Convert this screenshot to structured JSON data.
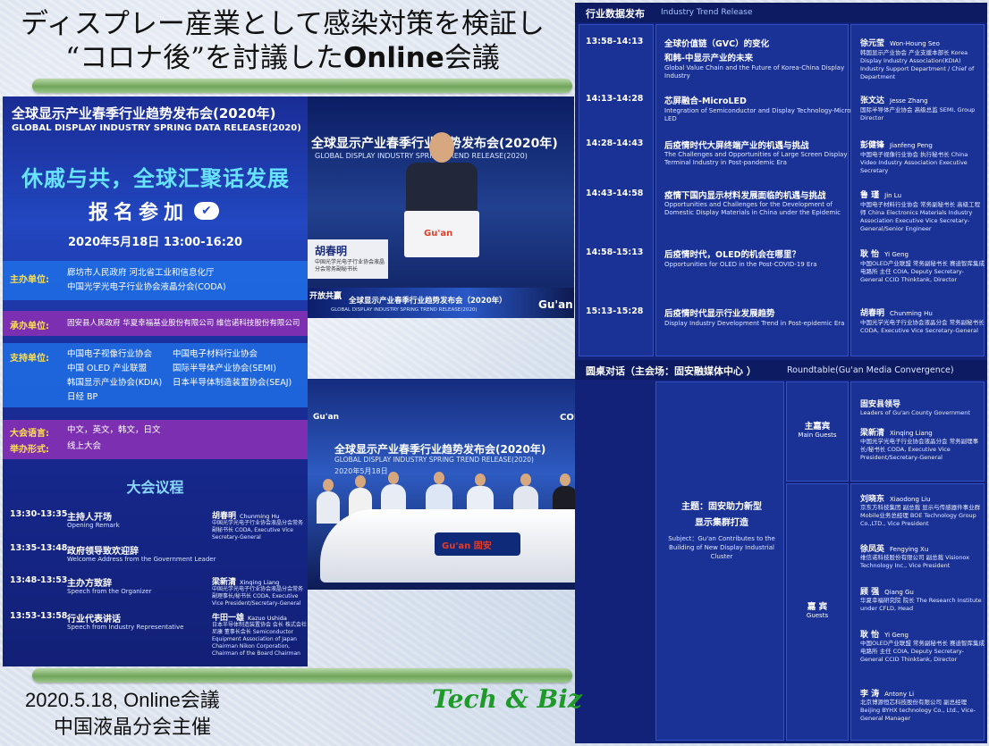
{
  "slide": {
    "title_line1": "ディスプレー産業として感染対策を検証し",
    "title_line2_prefix": "“コロナ後”を討議した",
    "title_line2_bold": "Online",
    "title_line2_suffix": "会議",
    "footer_date": "2020.5.18, Online会議",
    "footer_host": "中国液晶分会主催",
    "brand": "Tech & Biz"
  },
  "poster": {
    "title_zh": "全球显示产业春季行业趋势发布会(2020年)",
    "title_en": "GLOBAL DISPLAY INDUSTRY SPRING DATA RELEASE(2020)",
    "slogan": "休戚与共，全球汇聚话发展",
    "register": "报名参加",
    "check": "✔",
    "date": "2020年5月18日 13:00-16:20",
    "host_label": "主办单位:",
    "host_line1": "廊坊市人民政府   河北省工业和信息化厅",
    "host_line2": "中国光学光电子行业协会液晶分会(CODA)",
    "organizer_label": "承办单位:",
    "organizer_value": "固安县人民政府   华夏幸福基业股份有限公司   维信诺科技股份有限公司",
    "support_label": "支持单位:",
    "support_l1a": "中国电子视像行业协会",
    "support_l1b": "中国电子材料行业协会",
    "support_l2a": "中国 OLED 产业联盟",
    "support_l2b": "国际半导体产业协会(SEMI)",
    "support_l3a": "韩国显示产业协会(KDIA)",
    "support_l3b": "日本半导体制造装置协会(SEAJ)",
    "support_l4": "日经 BP",
    "lang_label": "大会语言:",
    "lang_value": "中文，英文，韩文，日文",
    "format_label": "举办形式:",
    "format_value": "线上大会",
    "agenda_title": "大会议程",
    "agenda": [
      {
        "time": "13:30-13:35",
        "zh": "主持人开场",
        "en": "Opening Remark",
        "speaker": "胡春明",
        "speaker_en": "Chunming Hu",
        "desc": "中国光学光电子行业协会液晶分会常务副秘书长 CODA, Executive Vice Secretary-General"
      },
      {
        "time": "13:35-13:48",
        "zh": "政府领导致欢迎辞",
        "en": "Welcome Address from the Government Leader",
        "speaker": "",
        "speaker_en": "",
        "desc": ""
      },
      {
        "time": "13:48-13:53",
        "zh": "主办方致辞",
        "en": "Speech from the Organizer",
        "speaker": "梁新清",
        "speaker_en": "Xinqing Liang",
        "desc": "中国光学光电子行业协会液晶分会常务副理事长/秘书长 CODA, Executive Vice President/Secretary-General"
      },
      {
        "time": "13:53-13:58",
        "zh": "行业代表讲话",
        "en": "Speech from Industry Representative",
        "speaker": "牛田一雄",
        "speaker_en": "Kazuo Ushida",
        "desc": "日本半导体制造装置协会 会长 株式会社尼康 董事长会长 Semiconductor Equipment Association of Japan Chairman Nikon Corporation, Chairman of the Board Chairman"
      }
    ]
  },
  "frame1": {
    "banner_zh": "全球显示产业春季行业趋势发布会(2020年)",
    "banner_en": "GLOBAL DISPLAY INDUSTRY SPRING TREND RELEASE(2020)",
    "name": "胡春明",
    "name_title": "中国光学光电子行业协会液晶分会常务副秘书长",
    "ticker_zh": "全球显示产业春季行业趋势发布会（2020年）",
    "ticker_en": "GLOBAL DISPLAY INDUSTRY SPRING TREND RELEASE(2020)",
    "logo": "Gu'an",
    "podium_logo": "Gu'an",
    "ticker_left": "开放共赢"
  },
  "frame2": {
    "logo_left": "Gu'an",
    "logo_coda": "CODA",
    "banner_zh": "全球显示产业春季行业趋势发布会(2020年)",
    "banner_en": "GLOBAL DISPLAY INDUSTRY SPRING TREND RELEASE(2020)",
    "date": "2020年5月18日",
    "desk_logo": "Gu'an 固安"
  },
  "program": {
    "release_header_zh": "行业数据发布",
    "release_header_en": "Industry Trend Release",
    "items": [
      {
        "time": "13:58-14:13",
        "zh1": "全球价值链（GVC）的变化",
        "zh2": "和韩-中显示产业的未来",
        "en": "Global Value Chain and the Future of Korea-China Display Industry",
        "speaker": "徐元莹",
        "speaker_en": "Won-Houng Seo",
        "desc": "韩国显示产业协会 产业支援本部长 Korea Display Industry Association(KDIA) Industry Support Department / Chief of Department"
      },
      {
        "time": "14:13-14:28",
        "zh1": "芯屏融合-MicroLED",
        "zh2": "",
        "en": "Integration of Semiconductor and Display Technology-Micro LED",
        "speaker": "张文达",
        "speaker_en": "Jesse Zhang",
        "desc": "国际半导体产业协会 高级总监 SEMI, Group Director"
      },
      {
        "time": "14:28-14:43",
        "zh1": "后疫情时代大屏终端产业的机遇与挑战",
        "zh2": "",
        "en": "The Challenges and Opportunities of Large Screen Display Terminal Industry in Post-pandemic Era",
        "speaker": "彭健锋",
        "speaker_en": "Jianfeng Peng",
        "desc": "中国电子视像行业协会 执行秘书长 China Video Industry Association Executive Secretary"
      },
      {
        "time": "14:43-14:58",
        "zh1": "疫情下国内显示材料发展面临的机遇与挑战",
        "zh2": "",
        "en": "Opportunities and Challenges for the Development of Domestic Display Materials in China under the Epidemic",
        "speaker": "鲁  瑾",
        "speaker_en": "Jin Lu",
        "desc": "中国电子材料行业协会 常务副秘书长 高级工程师 China Electronics Materials Industry Association Executive Vice Secretary-General/Senior Engineer"
      },
      {
        "time": "14:58-15:13",
        "zh1": "后疫情时代，OLED的机会在哪里？",
        "zh2": "",
        "en": "Opportunities for OLED in the Post-COVID-19 Era",
        "speaker": "耿  怡",
        "speaker_en": "Yi Geng",
        "desc": "中国OLED产业联盟 常务副秘书长 赛迪智库集成电路所 主任 COIA, Deputy Secretary-General CCID Thinktank, Director"
      },
      {
        "time": "15:13-15:28",
        "zh1": "后疫情时代显示行业发展趋势",
        "zh2": "",
        "en": "Display Industry Development Trend in Post-epidemic Era",
        "speaker": "胡春明",
        "speaker_en": "Chunming Hu",
        "desc": "中国光学光电子行业协会液晶分会 常务副秘书长 CODA, Executive Vice Secretary-General"
      }
    ],
    "roundtable_zh": "圆桌对话（主会场：固安融媒体中心 ）",
    "roundtable_en": "Roundtable(Gu'an Media Convergence)",
    "theme_zh1": "主题：固安助力新型",
    "theme_zh2": "显示集群打造",
    "theme_en": "Subject：Gu'an Contributes to the Building of New Display Industrial Cluster",
    "main_guests_zh": "主嘉宾",
    "main_guests_en": "Main Guests",
    "guests_zh": "嘉  宾",
    "guests_en": "Guests",
    "main_guests": [
      {
        "name": "固安县领导",
        "en": "",
        "desc": "Leaders of Gu'an County Government"
      },
      {
        "name": "梁新清",
        "en": "Xinqing Liang",
        "desc": "中国光学光电子行业协会液晶分会 常务副理事长/秘书长 CODA, Executive Vice President/Secretary-General"
      }
    ],
    "guests": [
      {
        "name": "刘晓东",
        "en": "Xiaodong Liu",
        "desc": "京东方科技集团 副总裁 显示与传感器件事业群 Mobile业务总经理 BOE Technology Group Co.,LTD., Vice President"
      },
      {
        "name": "徐凤英",
        "en": "Fengying Xu",
        "desc": "维信诺科技股份有限公司 副总裁 Visionox Technology Inc., Vice President"
      },
      {
        "name": "顾  强",
        "en": "Qiang Gu",
        "desc": "华夏幸福研究院 院长 The Research Institute under CFLD, Head"
      },
      {
        "name": "耿  怡",
        "en": "Yi Geng",
        "desc": "中国OLED产业联盟 常务副秘书长 赛迪智库集成电路所 主任 COIA, Deputy Secretary-General CCID Thinktank, Director"
      },
      {
        "name": "李  涛",
        "en": "Antony Li",
        "desc": "北京博源恒芯科技股份有限公司 副总经理 Beijing BYHX technology Co., Ltd., Vice-General Manager"
      }
    ]
  }
}
